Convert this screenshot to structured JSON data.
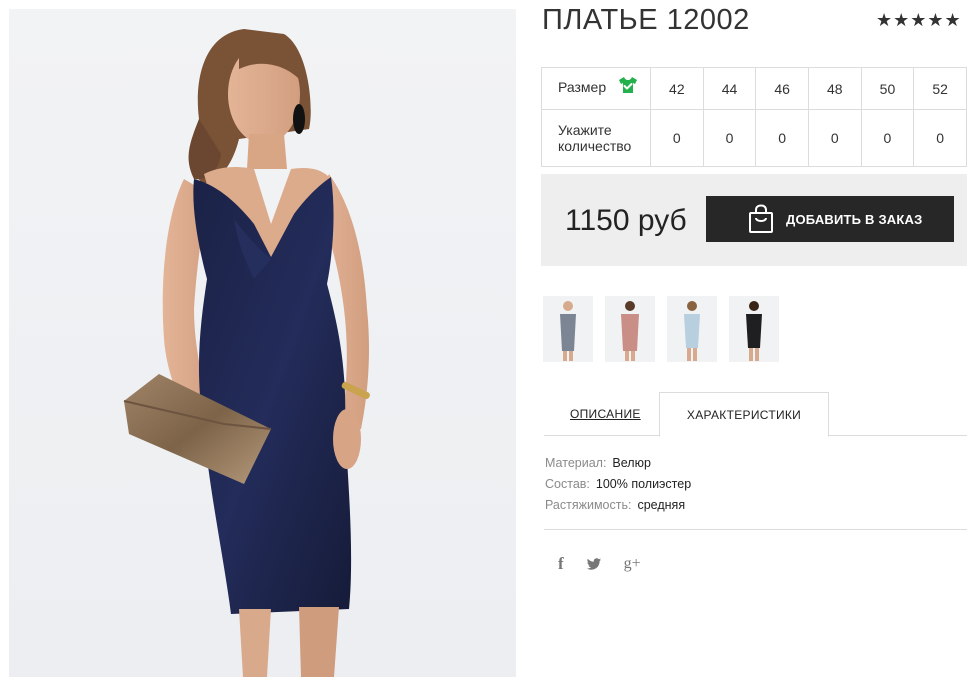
{
  "product": {
    "title": "ПЛАТЬЕ 12002",
    "rating_stars": "★★★★★",
    "rating_value": 5
  },
  "size_table": {
    "size_label": "Размер",
    "qty_label_line1": "Укажите",
    "qty_label_line2": "количество",
    "sizes": [
      "42",
      "44",
      "46",
      "48",
      "50",
      "52"
    ],
    "quantities": [
      "0",
      "0",
      "0",
      "0",
      "0",
      "0"
    ],
    "size_icon": "tshirt-check-icon",
    "size_icon_color": "#22b14c"
  },
  "buy": {
    "price": "1150 руб",
    "add_button_label": "ДОБАВИТЬ В ЗАКАЗ",
    "bag_icon": "shopping-bag-icon"
  },
  "thumbnails": [
    {
      "dress_color": "#7c8593"
    },
    {
      "dress_color": "#c98e86"
    },
    {
      "dress_color": "#b8cfe0"
    },
    {
      "dress_color": "#1f1f22"
    }
  ],
  "tabs": {
    "description": "ОПИСАНИЕ",
    "characteristics": "ХАРАКТЕРИСТИКИ",
    "active": "characteristics"
  },
  "characteristics": [
    {
      "key": "Материал:",
      "value": "Велюр"
    },
    {
      "key": "Состав:",
      "value": "100% полиэстер"
    },
    {
      "key": "Растяжимость:",
      "value": "средняя"
    }
  ],
  "social": {
    "facebook": "f",
    "twitter_icon": "twitter-icon",
    "googleplus": "g+"
  },
  "colors": {
    "dress": "#1c2447",
    "button_bg": "#272727",
    "buybox_bg": "#eeeeee"
  }
}
